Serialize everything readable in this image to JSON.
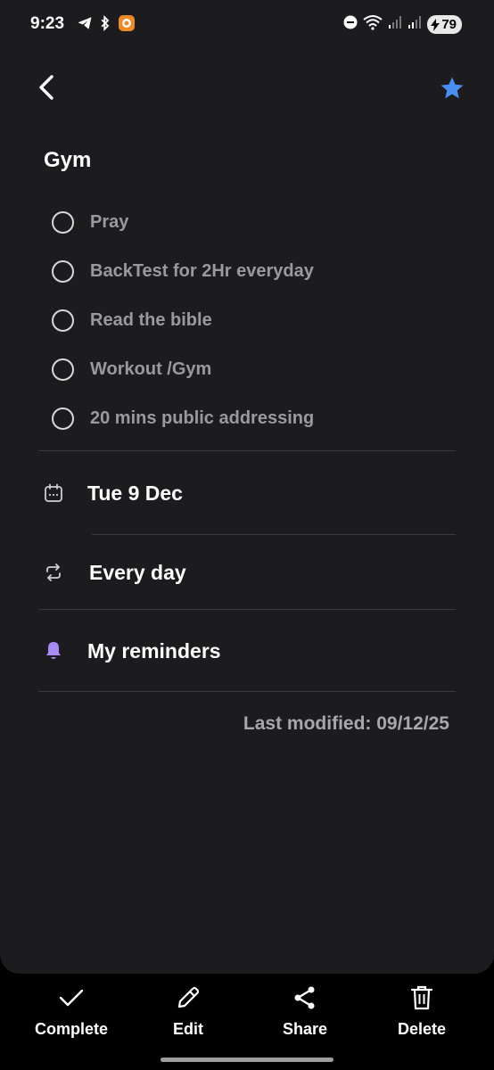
{
  "status_bar": {
    "time": "9:23",
    "battery_level": "79",
    "left_icons": [
      "telegram-icon",
      "bluetooth-icon",
      "app-notification-icon"
    ],
    "right_icons": [
      "dnd-icon",
      "wifi-icon",
      "signal-icon",
      "signal-icon",
      "battery-icon"
    ]
  },
  "header": {
    "back_icon": "chevron-left-icon",
    "star_icon": "star-icon",
    "star_color": "#4a8ef5"
  },
  "task": {
    "title": "Gym",
    "subtasks": [
      {
        "text": "Pray",
        "done": false
      },
      {
        "text": "BackTest for 2Hr everyday",
        "done": false
      },
      {
        "text": "Read the bible",
        "done": false
      },
      {
        "text": "Workout /Gym",
        "done": false
      },
      {
        "text": "20 mins public addressing",
        "done": false
      }
    ],
    "date": "Tue 9 Dec",
    "repeat": "Every day",
    "reminder_list": "My reminders",
    "reminder_color": "#a98bf5",
    "last_modified": "Last modified: 09/12/25"
  },
  "toolbar": {
    "complete_label": "Complete",
    "edit_label": "Edit",
    "share_label": "Share",
    "delete_label": "Delete"
  }
}
